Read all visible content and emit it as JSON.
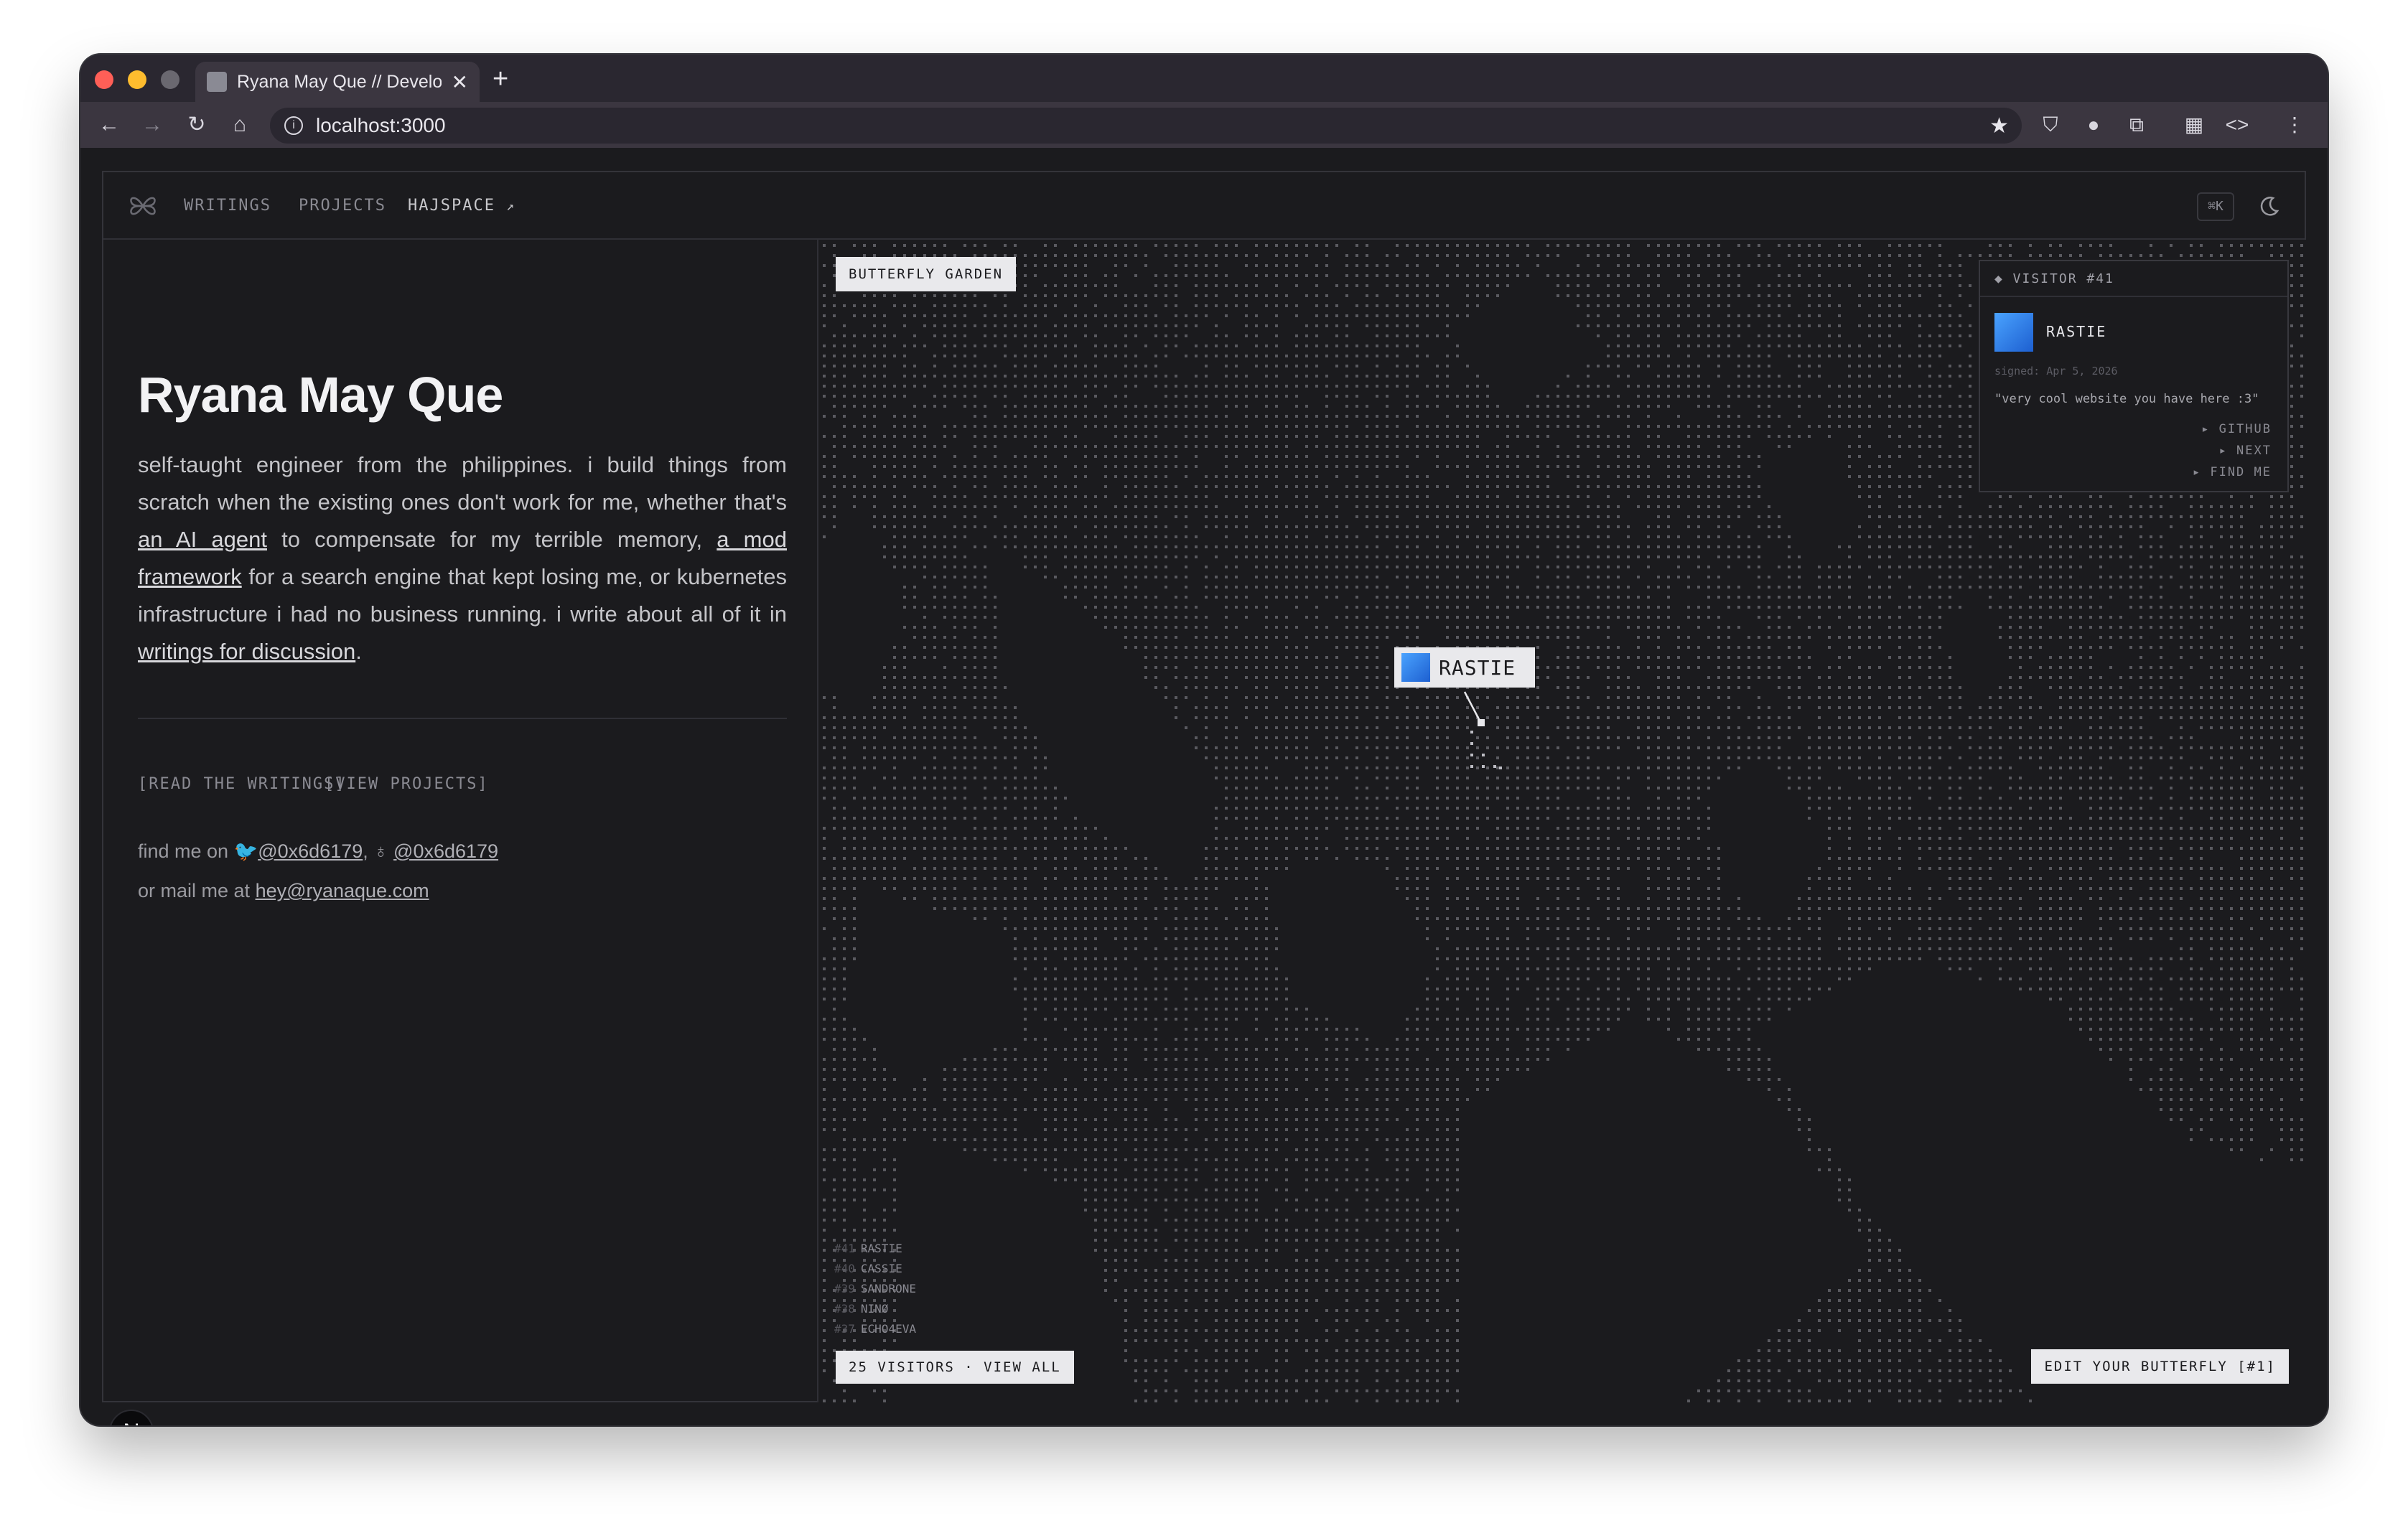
{
  "browser": {
    "tab_title": "Ryana May Que // Develo",
    "url": "localhost:3000",
    "new_tab": "+"
  },
  "site": {
    "nav": [
      "WRITINGS",
      "PROJECTS",
      "HAJSPACE"
    ],
    "kbd": "⌘K"
  },
  "hero": {
    "title": "Ryana May Que",
    "bio_1": "self-taught engineer from the philippines. i build things from scratch when the existing ones don't work for me, whether that's ",
    "link_agent": "an AI agent",
    "bio_2": " to compensate for my terrible memory, ",
    "link_mod": "a mod framework",
    "bio_3": " for a search engine that kept losing me, or kubernetes infrastructure i had no business running. i write about all of it in ",
    "link_writings": "writings for discussion",
    "bio_4": ".",
    "cta_writings": "[READ THE WRITINGS]",
    "cta_projects": "[VIEW PROJECTS]",
    "find_me": "find me on",
    "handle_1": "@0x6d6179",
    "sep": ",",
    "handle_2": "@0x6d6179",
    "mail_me": "or mail me at",
    "email": "hey@ryanaque.com",
    "n_badge": "N"
  },
  "garden": {
    "title": "BUTTERFLY GARDEN",
    "visitor_card": {
      "header": "◆ VISITOR #41",
      "name": "RASTIE",
      "signed": "signed: Apr 5, 2026",
      "message": "\"very cool website you have here :3\"",
      "links": [
        "▸ GITHUB",
        "▸ NEXT",
        "▸ FIND ME"
      ]
    },
    "butterfly_label": "RASTIE",
    "recent": [
      {
        "num": "#41",
        "name": "RASTIE"
      },
      {
        "num": "#40",
        "name": "CASSIE"
      },
      {
        "num": "#39",
        "name": "SANDRONE"
      },
      {
        "num": "#38",
        "name": "NINØ"
      },
      {
        "num": "#37",
        "name": "ECHO4EVA"
      }
    ],
    "visitors_button": "25 VISITORS · VIEW ALL",
    "edit_button": "EDIT YOUR BUTTERFLY [#1]"
  }
}
